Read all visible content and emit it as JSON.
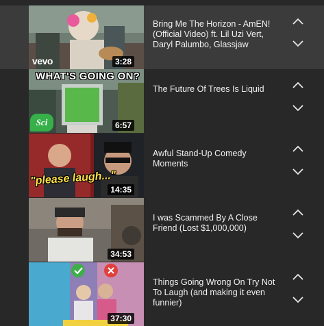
{
  "queue": {
    "items": [
      {
        "title": "Bring Me The Horizon - AmEN! (Official Video) ft. Lil Uzi Vert, Daryl Palumbo, Glassjaw",
        "duration": "3:28",
        "thumb_label": "vevo",
        "active": true
      },
      {
        "title": "The Future Of Trees Is Liquid",
        "duration": "6:57",
        "thumb_label": "WHAT'S GOING ON?",
        "thumb_logo": "Sci",
        "active": false
      },
      {
        "title": "Awful Stand-Up Comedy Moments",
        "duration": "14:35",
        "thumb_label": "\"please laugh...\"",
        "active": false
      },
      {
        "title": "I was Scammed By A Close Friend (Lost $1,000,000)",
        "duration": "34:53",
        "active": false
      },
      {
        "title": "Things Going Wrong On Try Not To Laugh (and making it even funnier)",
        "duration": "37:30",
        "active": false
      }
    ],
    "controls": {
      "move_up_icon": "chevron-up-icon",
      "move_down_icon": "chevron-down-icon"
    }
  },
  "colors": {
    "background": "#282828",
    "active_row": "#3b3b3b",
    "text": "#f1f1f1",
    "chevron": "#e8e8e8"
  }
}
